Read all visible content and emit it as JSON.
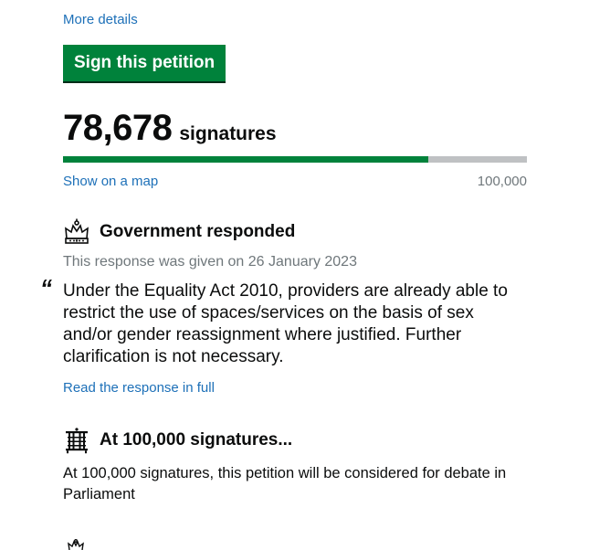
{
  "petition": {
    "more_details_link": "More details",
    "sign_button": "Sign this petition",
    "signature_count": "78,678",
    "signature_label": "signatures",
    "progress_fraction": 0.78678,
    "show_map_link": "Show on a map",
    "target_count": "100,000"
  },
  "government_response": {
    "icon": "crown-icon",
    "heading": "Government responded",
    "date_text": "This response was given on 26 January 2023",
    "quote_mark": "“",
    "summary": "Under the Equality Act 2010, providers are already able to restrict the use of spaces/services on the basis of sex and/or gender reassignment where justified. Further clarification is not necessary.",
    "read_full_link": "Read the response in full"
  },
  "debate_threshold": {
    "icon": "portcullis-icon",
    "heading": "At 100,000 signatures...",
    "text": "At 100,000 signatures, this petition will be considered for debate in Parliament"
  },
  "colors": {
    "link": "#1d70b8",
    "button": "#00823b",
    "progress_fill": "#00823b",
    "progress_track": "#bfc1c3",
    "muted_text": "#6f777b"
  }
}
